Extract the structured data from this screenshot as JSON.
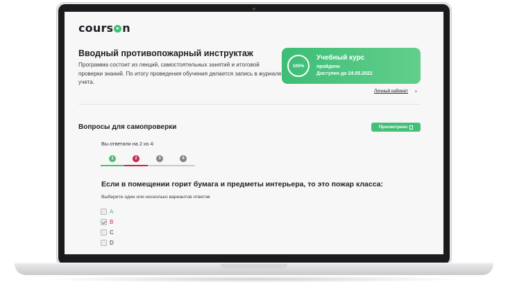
{
  "brand": {
    "logo_text_before": "cours",
    "logo_text_after": "n"
  },
  "course": {
    "title": "Вводный противопожарный инструктаж",
    "description": "Программа состоит из лекций, самостоятельных занятий и итоговой проверки знаний. По итогу проведения обучения делается запись в журнале учета."
  },
  "status_card": {
    "progress_label": "100%",
    "progress": 1.0,
    "title": "Учебный курс",
    "status": "пройдено",
    "available_until": "Доступен до 24.05.2022"
  },
  "cabinet_link": {
    "label": "Личный кабинет",
    "arrow": "›"
  },
  "self_check": {
    "title": "Вопросы для самопроверки",
    "viewed_label": "Просмотрено",
    "answered_text": "Вы ответили на 2 из 4:",
    "steps": [
      {
        "label": "1",
        "color": "#4cbd74",
        "state": "correct"
      },
      {
        "label": "2",
        "color": "#c8244a",
        "state": "incorrect"
      },
      {
        "label": "3",
        "color": "#828287",
        "state": "unanswered"
      },
      {
        "label": "4",
        "color": "#828287",
        "state": "unanswered"
      }
    ]
  },
  "question": {
    "text": "Если в помещении горит бумага и предметы интерьера, то это пожар класса:",
    "hint": "Выберите один или несколько вариантов ответов",
    "options": [
      {
        "label": "A",
        "checked": false,
        "color": "#3fb872"
      },
      {
        "label": "B",
        "checked": true,
        "color": "#c8244a"
      },
      {
        "label": "C",
        "checked": false,
        "color": "#2e2e33"
      },
      {
        "label": "D",
        "checked": false,
        "color": "#2e2e33"
      }
    ]
  }
}
